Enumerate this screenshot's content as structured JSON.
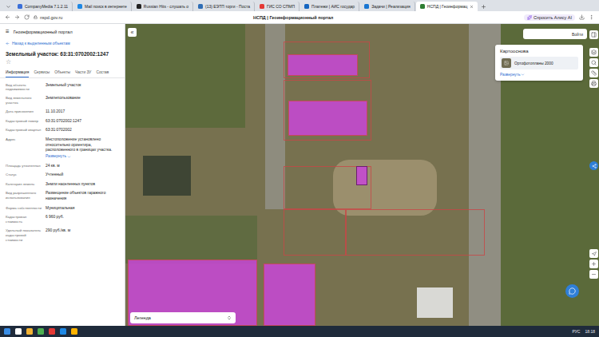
{
  "browser": {
    "tabs": [
      {
        "label": "CompanyMedia 7.1.2.11",
        "selected": false,
        "color": "#3b6fd8"
      },
      {
        "label": "Mail поиск в интернете",
        "selected": false,
        "color": "#1e88e5"
      },
      {
        "label": "Russian Hits - слушать о",
        "selected": false,
        "color": "#222222"
      },
      {
        "label": "(13) ЕЭТП торги - Поста",
        "selected": false,
        "color": "#2f6db5"
      },
      {
        "label": "ГИС СО СПМП",
        "selected": false,
        "color": "#e53935"
      },
      {
        "label": "Платежи | АИС государ",
        "selected": false,
        "color": "#1565c0"
      },
      {
        "label": "Задачи | Реализация",
        "selected": false,
        "color": "#1976d2"
      },
      {
        "label": "НСПД | Геоинформац",
        "selected": true,
        "color": "#2e7d32"
      }
    ],
    "address": "nspd.gov.ru",
    "page_title": "НСПД | Геоинформационный портал",
    "alice_button": "Спросить Алису AI"
  },
  "sidebar": {
    "menu_icon": "≡",
    "app_title": "Геоинформационный портал",
    "back_link": "Назад к выделенным объектам",
    "object_title": "Земельный участок: 63:31:0702002:1247",
    "favorite_icon": "☆",
    "favorite": false,
    "tabs": [
      {
        "label": "Информация",
        "selected": true
      },
      {
        "label": "Сервисы",
        "selected": false
      },
      {
        "label": "Объекты",
        "selected": false
      },
      {
        "label": "Части ЗУ",
        "selected": false
      },
      {
        "label": "Состав",
        "selected": false
      }
    ],
    "fields": [
      {
        "label": "Вид объекта недвижимости",
        "value": "Земельный участок"
      },
      {
        "label": "Вид земельного участка",
        "value": "Землепользование"
      },
      {
        "label": "Дата присвоения",
        "value": "11.10.2017"
      },
      {
        "label": "Кадастровый номер",
        "value": "63:31:0702002:1247"
      },
      {
        "label": "Кадастровый квартал",
        "value": "63:31:0702002"
      },
      {
        "label": "Адрес",
        "value": "Местоположение установлено относительно ориентира, расположенного в границах участка.",
        "link": "Развернуть"
      },
      {
        "label": "Площадь уточненная",
        "value": "24 кв. м"
      },
      {
        "label": "Статус",
        "value": "Учтенный"
      },
      {
        "label": "Категория земель",
        "value": "Земли населенных пунктов"
      },
      {
        "label": "Вид разрешенного использования",
        "value": "Размещение объектов гаражного назначения"
      },
      {
        "label": "Форма собственности",
        "value": "Муниципальная"
      },
      {
        "label": "Кадастровая стоимость",
        "value": "6 960 руб."
      },
      {
        "label": "Удельный показатель кадастровой стоимости",
        "value": "290 руб./кв. м"
      }
    ]
  },
  "map": {
    "collapse": "«",
    "login": "Войти",
    "basemap": {
      "title": "Картооснова",
      "layer": "Ортофотопланы 2000",
      "expand": "Развернуть"
    },
    "legend": "Легенда"
  },
  "taskbar": {
    "language": "РУС",
    "time": "18:18"
  }
}
